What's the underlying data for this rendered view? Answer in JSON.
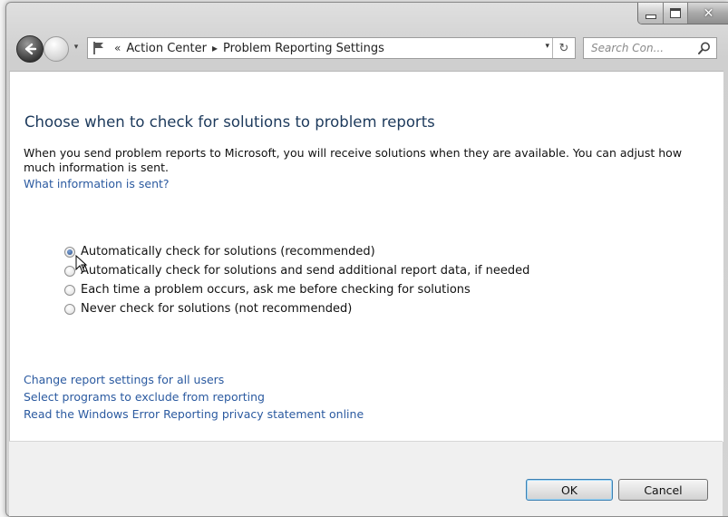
{
  "window": {
    "caption_buttons": {
      "minimize": "minimize",
      "maximize": "maximize",
      "close": "✕"
    }
  },
  "nav": {
    "breadcrumb_prefix": "«",
    "breadcrumbs": [
      "Action Center",
      "Problem Reporting Settings"
    ],
    "breadcrumb_separator": "▸",
    "refresh_glyph": "↻",
    "dropdown_glyph": "▾",
    "search_placeholder": "Search Con..."
  },
  "main": {
    "title": "Choose when to check for solutions to problem reports",
    "intro": "When you send problem reports to Microsoft, you will receive solutions when they are available. You can adjust how much information is sent.",
    "what_link": "What information is sent?",
    "options": [
      {
        "label": "Automatically check for solutions (recommended)",
        "checked": true
      },
      {
        "label": "Automatically check for solutions and send additional report data, if needed",
        "checked": false
      },
      {
        "label": "Each time a problem occurs, ask me before checking for solutions",
        "checked": false
      },
      {
        "label": "Never check for solutions (not recommended)",
        "checked": false
      }
    ],
    "links": [
      "Change report settings for all users",
      "Select programs to exclude from reporting",
      "Read the Windows Error Reporting privacy statement online"
    ]
  },
  "footer": {
    "ok": "OK",
    "cancel": "Cancel"
  },
  "colors": {
    "title": "#1d3a5c",
    "link": "#2b5aa0",
    "window_frame": "#d4d4d4"
  }
}
